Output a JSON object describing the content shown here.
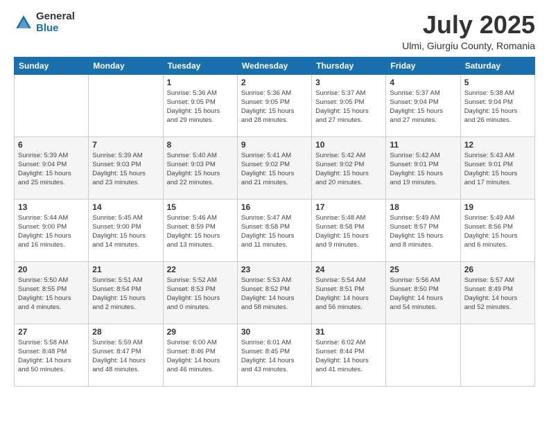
{
  "header": {
    "logo_general": "General",
    "logo_blue": "Blue",
    "month": "July 2025",
    "location": "Ulmi, Giurgiu County, Romania"
  },
  "days_of_week": [
    "Sunday",
    "Monday",
    "Tuesday",
    "Wednesday",
    "Thursday",
    "Friday",
    "Saturday"
  ],
  "weeks": [
    [
      {
        "day": "",
        "info": ""
      },
      {
        "day": "",
        "info": ""
      },
      {
        "day": "1",
        "info": "Sunrise: 5:36 AM\nSunset: 9:05 PM\nDaylight: 15 hours\nand 29 minutes."
      },
      {
        "day": "2",
        "info": "Sunrise: 5:36 AM\nSunset: 9:05 PM\nDaylight: 15 hours\nand 28 minutes."
      },
      {
        "day": "3",
        "info": "Sunrise: 5:37 AM\nSunset: 9:05 PM\nDaylight: 15 hours\nand 27 minutes."
      },
      {
        "day": "4",
        "info": "Sunrise: 5:37 AM\nSunset: 9:04 PM\nDaylight: 15 hours\nand 27 minutes."
      },
      {
        "day": "5",
        "info": "Sunrise: 5:38 AM\nSunset: 9:04 PM\nDaylight: 15 hours\nand 26 minutes."
      }
    ],
    [
      {
        "day": "6",
        "info": "Sunrise: 5:39 AM\nSunset: 9:04 PM\nDaylight: 15 hours\nand 25 minutes."
      },
      {
        "day": "7",
        "info": "Sunrise: 5:39 AM\nSunset: 9:03 PM\nDaylight: 15 hours\nand 23 minutes."
      },
      {
        "day": "8",
        "info": "Sunrise: 5:40 AM\nSunset: 9:03 PM\nDaylight: 15 hours\nand 22 minutes."
      },
      {
        "day": "9",
        "info": "Sunrise: 5:41 AM\nSunset: 9:02 PM\nDaylight: 15 hours\nand 21 minutes."
      },
      {
        "day": "10",
        "info": "Sunrise: 5:42 AM\nSunset: 9:02 PM\nDaylight: 15 hours\nand 20 minutes."
      },
      {
        "day": "11",
        "info": "Sunrise: 5:42 AM\nSunset: 9:01 PM\nDaylight: 15 hours\nand 19 minutes."
      },
      {
        "day": "12",
        "info": "Sunrise: 5:43 AM\nSunset: 9:01 PM\nDaylight: 15 hours\nand 17 minutes."
      }
    ],
    [
      {
        "day": "13",
        "info": "Sunrise: 5:44 AM\nSunset: 9:00 PM\nDaylight: 15 hours\nand 16 minutes."
      },
      {
        "day": "14",
        "info": "Sunrise: 5:45 AM\nSunset: 9:00 PM\nDaylight: 15 hours\nand 14 minutes."
      },
      {
        "day": "15",
        "info": "Sunrise: 5:46 AM\nSunset: 8:59 PM\nDaylight: 15 hours\nand 13 minutes."
      },
      {
        "day": "16",
        "info": "Sunrise: 5:47 AM\nSunset: 8:58 PM\nDaylight: 15 hours\nand 11 minutes."
      },
      {
        "day": "17",
        "info": "Sunrise: 5:48 AM\nSunset: 8:58 PM\nDaylight: 15 hours\nand 9 minutes."
      },
      {
        "day": "18",
        "info": "Sunrise: 5:49 AM\nSunset: 8:57 PM\nDaylight: 15 hours\nand 8 minutes."
      },
      {
        "day": "19",
        "info": "Sunrise: 5:49 AM\nSunset: 8:56 PM\nDaylight: 15 hours\nand 6 minutes."
      }
    ],
    [
      {
        "day": "20",
        "info": "Sunrise: 5:50 AM\nSunset: 8:55 PM\nDaylight: 15 hours\nand 4 minutes."
      },
      {
        "day": "21",
        "info": "Sunrise: 5:51 AM\nSunset: 8:54 PM\nDaylight: 15 hours\nand 2 minutes."
      },
      {
        "day": "22",
        "info": "Sunrise: 5:52 AM\nSunset: 8:53 PM\nDaylight: 15 hours\nand 0 minutes."
      },
      {
        "day": "23",
        "info": "Sunrise: 5:53 AM\nSunset: 8:52 PM\nDaylight: 14 hours\nand 58 minutes."
      },
      {
        "day": "24",
        "info": "Sunrise: 5:54 AM\nSunset: 8:51 PM\nDaylight: 14 hours\nand 56 minutes."
      },
      {
        "day": "25",
        "info": "Sunrise: 5:56 AM\nSunset: 8:50 PM\nDaylight: 14 hours\nand 54 minutes."
      },
      {
        "day": "26",
        "info": "Sunrise: 5:57 AM\nSunset: 8:49 PM\nDaylight: 14 hours\nand 52 minutes."
      }
    ],
    [
      {
        "day": "27",
        "info": "Sunrise: 5:58 AM\nSunset: 8:48 PM\nDaylight: 14 hours\nand 50 minutes."
      },
      {
        "day": "28",
        "info": "Sunrise: 5:59 AM\nSunset: 8:47 PM\nDaylight: 14 hours\nand 48 minutes."
      },
      {
        "day": "29",
        "info": "Sunrise: 6:00 AM\nSunset: 8:46 PM\nDaylight: 14 hours\nand 46 minutes."
      },
      {
        "day": "30",
        "info": "Sunrise: 6:01 AM\nSunset: 8:45 PM\nDaylight: 14 hours\nand 43 minutes."
      },
      {
        "day": "31",
        "info": "Sunrise: 6:02 AM\nSunset: 8:44 PM\nDaylight: 14 hours\nand 41 minutes."
      },
      {
        "day": "",
        "info": ""
      },
      {
        "day": "",
        "info": ""
      }
    ]
  ]
}
